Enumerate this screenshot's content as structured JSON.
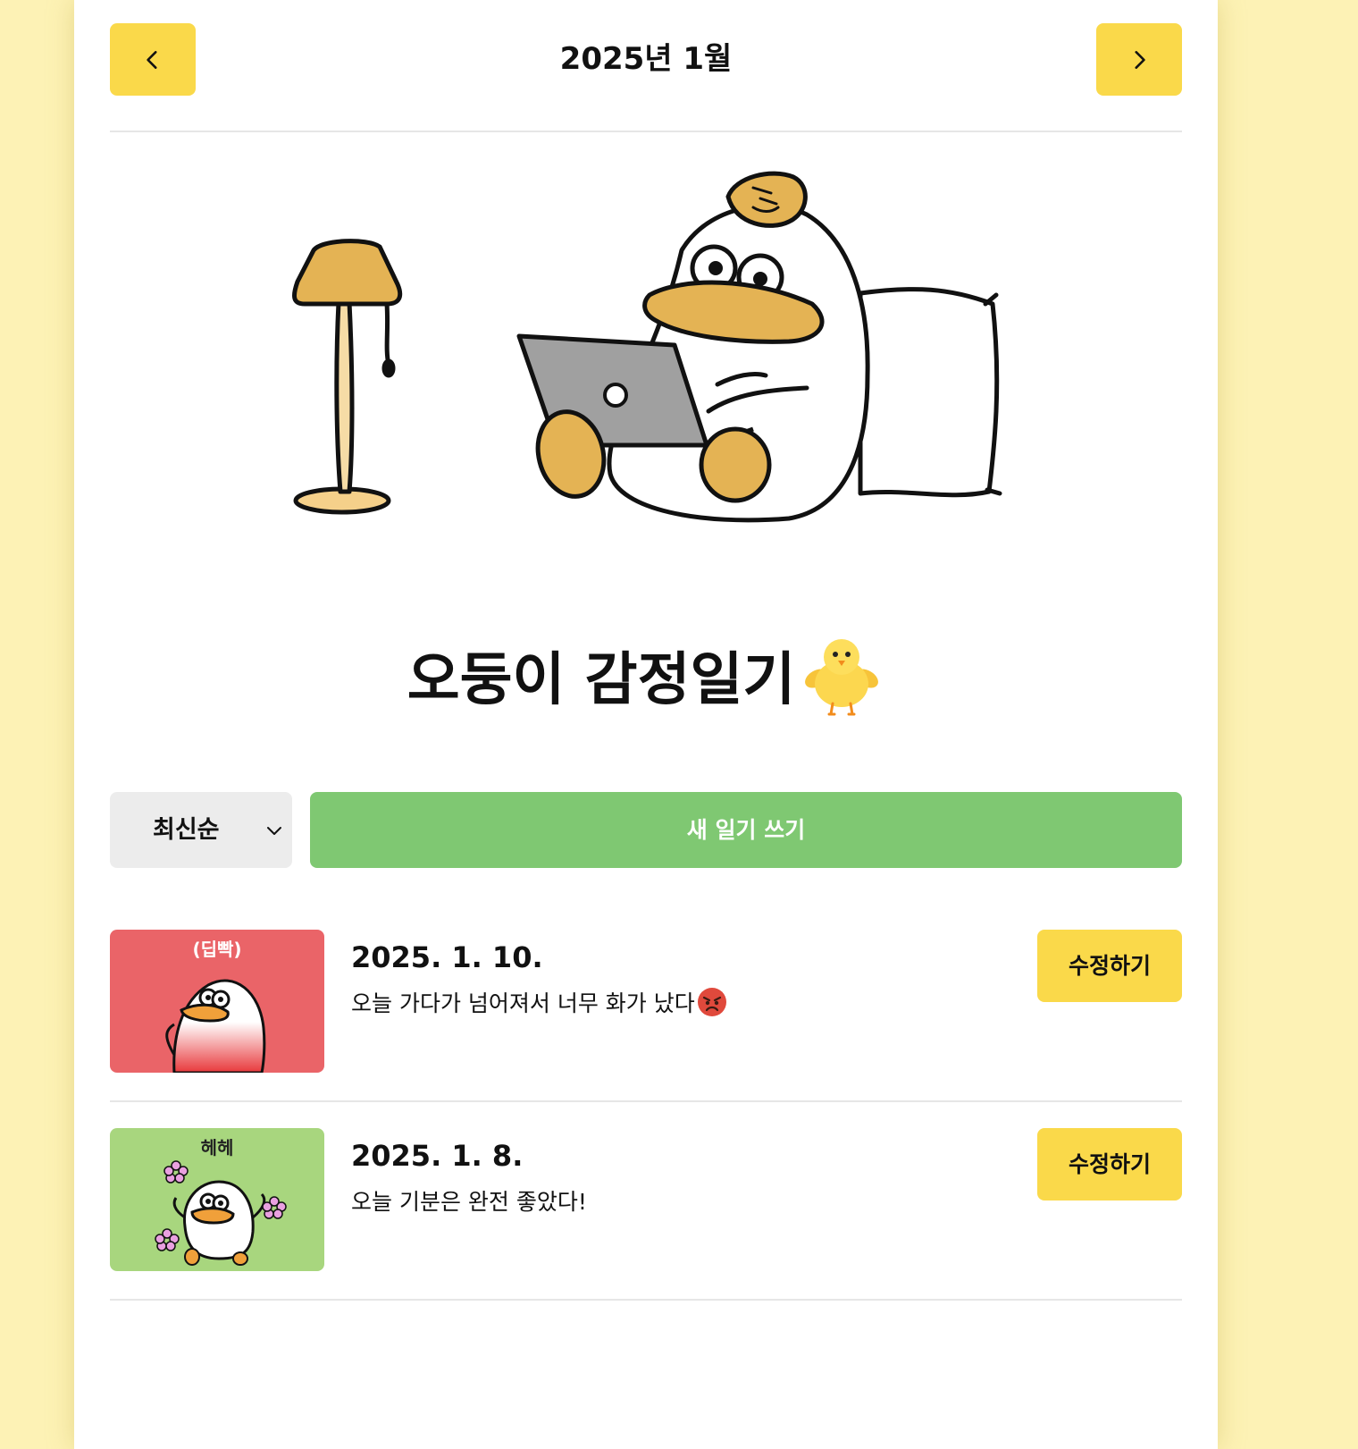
{
  "header": {
    "title": "2025년 1월",
    "prev_icon": "chevron-left-icon",
    "next_icon": "chevron-right-icon"
  },
  "hero": {
    "illustration": "duck-with-laptop-illustration"
  },
  "app": {
    "title": "오둥이 감정일기",
    "title_emoji": "baby-chick-emoji"
  },
  "controls": {
    "sort_selected": "최신순",
    "new_button": "새 일기 쓰기"
  },
  "entries": [
    {
      "thumb_caption": "(딥빡)",
      "date": "2025. 1. 10.",
      "content": "오늘 가다가 넘어져서 너무 화가 났다",
      "content_emoji": "angry-face-emoji",
      "edit_label": "수정하기"
    },
    {
      "thumb_caption": "헤헤",
      "date": "2025. 1. 8.",
      "content": "오늘 기분은 완전 좋았다!",
      "edit_label": "수정하기"
    }
  ],
  "colors": {
    "page_background": "#fdf2b5",
    "accent_yellow": "#fad94a",
    "accent_green": "#7fc872",
    "angry_thumb": "#ea6468",
    "happy_thumb": "#a8d67e"
  }
}
